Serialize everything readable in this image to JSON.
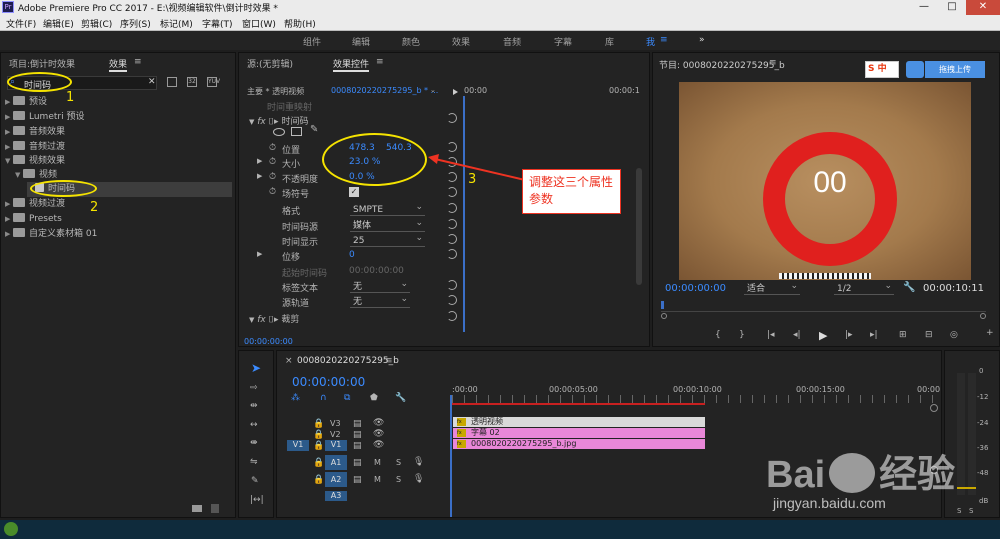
{
  "titlebar": {
    "title": "Adobe Premiere Pro CC 2017 - E:\\视频编辑软件\\倒计时效果 *",
    "logo": "Pr",
    "min": "—",
    "max": "□",
    "close": "✕"
  },
  "menu": [
    "文件(F)",
    "编辑(E)",
    "剪辑(C)",
    "序列(S)",
    "标记(M)",
    "字幕(T)",
    "窗口(W)",
    "帮助(H)"
  ],
  "workspace": {
    "tabs": [
      "组件",
      "编辑",
      "颜色",
      "效果",
      "音频",
      "字幕",
      "库",
      "我"
    ],
    "more": "»"
  },
  "project": {
    "tab1": "项目:倒计时效果",
    "tab2": "效果",
    "menu": "≡",
    "search": "时间码",
    "items": [
      {
        "label": "预设",
        "indent": 0,
        "expanded": false
      },
      {
        "label": "Lumetri 预设",
        "indent": 0,
        "expanded": false
      },
      {
        "label": "音频效果",
        "indent": 0,
        "expanded": false
      },
      {
        "label": "音频过渡",
        "indent": 0,
        "expanded": false
      },
      {
        "label": "视频效果",
        "indent": 0,
        "expanded": true
      },
      {
        "label": "视频",
        "indent": 1,
        "expanded": true
      },
      {
        "label": "时间码",
        "indent": 2,
        "expanded": false
      },
      {
        "label": "视频过渡",
        "indent": 0,
        "expanded": false
      },
      {
        "label": "Presets",
        "indent": 0,
        "expanded": false
      },
      {
        "label": "自定义素材箱 01",
        "indent": 0,
        "expanded": false
      }
    ]
  },
  "effects": {
    "source_tab": "源:(无剪辑)",
    "tab": "效果控件",
    "tab_menu": "≡",
    "master": "主要 * 透明视频",
    "clip": "0008020220275295_b * ...",
    "ruler_start": "00:00",
    "ruler_end": "00:00:1",
    "remap": "时间重映射",
    "timecode_fx": "时间码",
    "fx": "fx",
    "position": {
      "label": "位置",
      "x": "478.3",
      "y": "540.3"
    },
    "scale": {
      "label": "大小",
      "value": "23.0 %"
    },
    "opacity": {
      "label": "不透明度",
      "value": "0.0 %"
    },
    "field": {
      "label": "场符号"
    },
    "format": {
      "label": "格式",
      "value": "SMPTE"
    },
    "source": {
      "label": "时间码源",
      "value": "媒体"
    },
    "display": {
      "label": "时间显示",
      "value": "25"
    },
    "offset": {
      "label": "位移",
      "value": "0"
    },
    "start": {
      "label": "起始时间码",
      "value": "00:00:00:00"
    },
    "label_text": {
      "label": "标签文本",
      "value": "无"
    },
    "channel": {
      "label": "源轨道",
      "value": "无"
    },
    "crop": "裁剪",
    "timecode": "00:00:00:00"
  },
  "program": {
    "title": "节目: 0008020220275295_b",
    "menu": "≡",
    "display": "00",
    "timecode": "00:00:00:00",
    "fit": "适合",
    "res": "1/2",
    "duration": "00:00:10:11",
    "ime": "S 中",
    "upload": "拖拽上传"
  },
  "timeline": {
    "seq": "0008020220275295_b",
    "menu": "≡",
    "close": "×",
    "timecode": "00:00:00:00",
    "ticks": [
      ":00:00",
      "00:00:05:00",
      "00:00:10:00",
      "00:00:15:00",
      "00:00"
    ],
    "tracks": [
      {
        "name": "V3"
      },
      {
        "name": "V2"
      },
      {
        "name": "V1",
        "src": "V1"
      },
      {
        "name": "A1",
        "src": "A1"
      },
      {
        "name": "A2",
        "src": "A2"
      },
      {
        "name": "A3",
        "src": "A3"
      }
    ],
    "clips": [
      {
        "label": "透明视频",
        "color": "#d9d9d9"
      },
      {
        "label": "字幕 02",
        "color": "#e987d8"
      },
      {
        "label": "0008020220275295_b.jpg",
        "color": "#e987d8"
      }
    ]
  },
  "audio_meter": {
    "labels": [
      "0",
      "-12",
      "-24",
      "-36",
      "-48",
      "dB"
    ],
    "s": "S",
    "s2": "S"
  },
  "annotations": {
    "n1": "1",
    "n2": "2",
    "n3": "3",
    "callout": "调整这三个属性参数"
  },
  "watermark": {
    "brand": "Bai",
    "brand2": "经验",
    "url": "jingyan.baidu.com"
  }
}
